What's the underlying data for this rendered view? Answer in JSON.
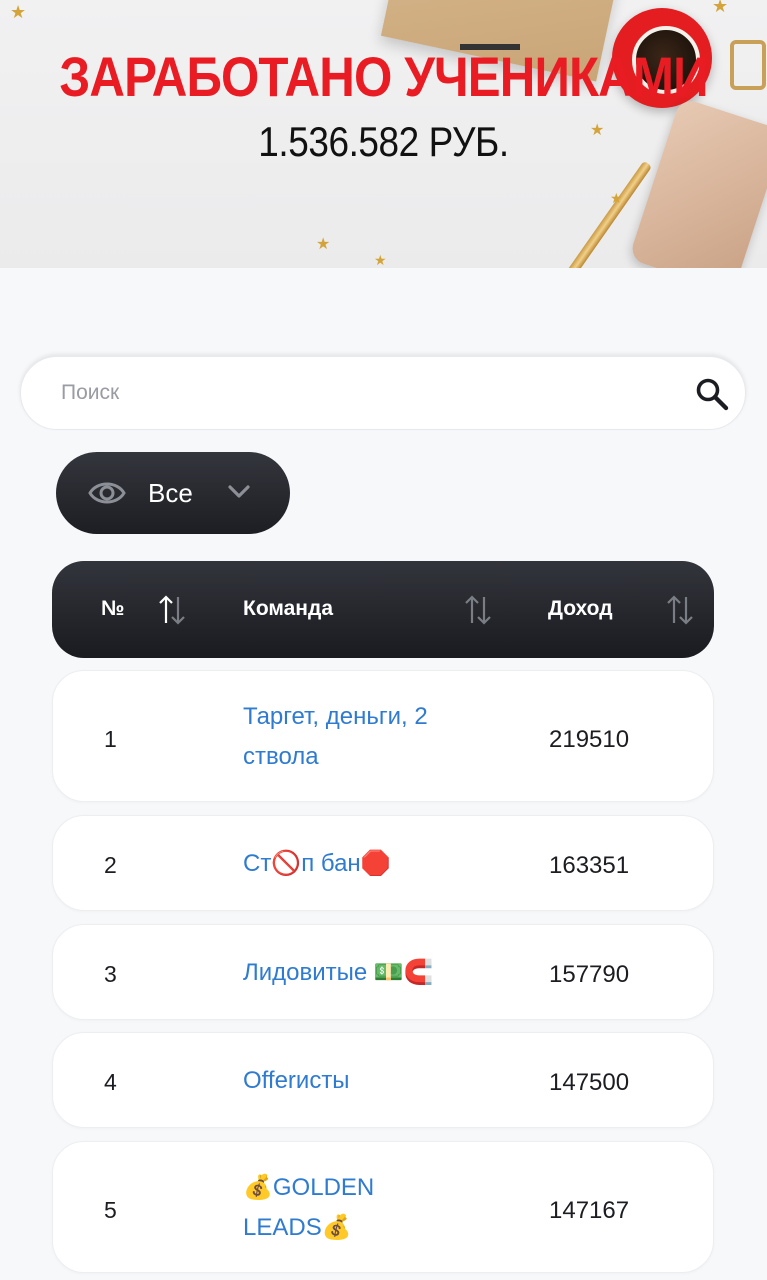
{
  "banner": {
    "title": "ЗАРАБОТАНО УЧЕНИКАМИ",
    "amount": "1.536.582 РУБ."
  },
  "search": {
    "placeholder": "Поиск",
    "value": ""
  },
  "filter": {
    "label": "Все"
  },
  "table": {
    "headers": {
      "num": "№",
      "team": "Команда",
      "income": "Доход"
    },
    "rows": [
      {
        "num": "1",
        "team": "Таргет, деньги, 2 ствола",
        "income": "219510"
      },
      {
        "num": "2",
        "team": "Ст🚫п бан🛑",
        "income": "163351"
      },
      {
        "num": "3",
        "team": "Лидовитые 💵🧲",
        "income": "157790"
      },
      {
        "num": "4",
        "team": "Offerисты",
        "income": "147500"
      },
      {
        "num": "5",
        "team": "💰GOLDEN LEADS💰",
        "income": "147167"
      }
    ]
  },
  "colors": {
    "accent_red": "#ea1c23",
    "link_blue": "#2f7bd0",
    "dark_bar": "#1d1e23",
    "background": "#f7f8fa"
  },
  "icons": {
    "search": "search-icon",
    "filter": "eye-icon",
    "dropdown": "chevron-down-icon",
    "sort": "sort-arrows-icon"
  }
}
